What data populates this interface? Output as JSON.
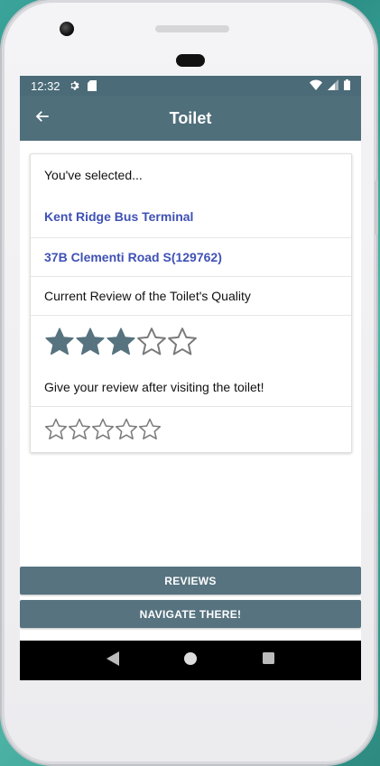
{
  "status_bar": {
    "time": "12:32",
    "icons": [
      "settings-icon",
      "sd-card-icon",
      "wifi-icon",
      "signal-icon",
      "battery-icon"
    ]
  },
  "app_bar": {
    "title": "Toilet",
    "back_icon": "arrow-left-icon"
  },
  "card": {
    "intro": "You've selected...",
    "location_name": "Kent Ridge Bus Terminal",
    "address": "37B Clementi Road S(129762)",
    "current_review_label": "Current Review of the Toilet's Quality",
    "current_rating": 3,
    "max_rating": 5,
    "give_review_label": "Give your review after visiting the toilet!",
    "user_rating": 0
  },
  "buttons": {
    "reviews": "REVIEWS",
    "navigate": "NAVIGATE THERE!"
  },
  "nav_bar": {
    "icons": [
      "back-triangle-icon",
      "home-circle-icon",
      "recents-square-icon"
    ]
  },
  "colors": {
    "primary": "#4f6f7b",
    "status_bar": "#4a6b77",
    "link_text": "#3f51b5",
    "star_fill": "#56737f",
    "star_outline": "#7a7a7a"
  }
}
